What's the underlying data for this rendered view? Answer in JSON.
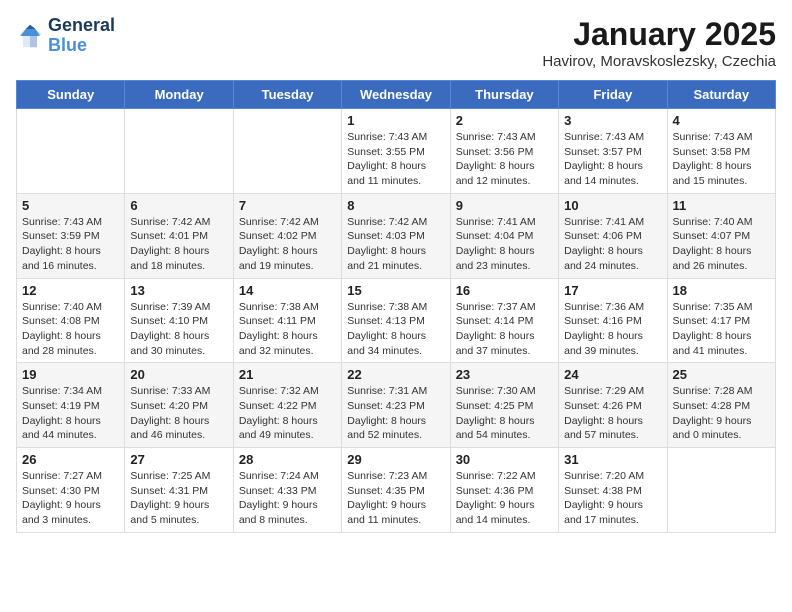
{
  "header": {
    "logo_line1": "General",
    "logo_line2": "Blue",
    "title": "January 2025",
    "subtitle": "Havirov, Moravskoslezsky, Czechia"
  },
  "days_of_week": [
    "Sunday",
    "Monday",
    "Tuesday",
    "Wednesday",
    "Thursday",
    "Friday",
    "Saturday"
  ],
  "weeks": [
    [
      {
        "day": "",
        "info": ""
      },
      {
        "day": "",
        "info": ""
      },
      {
        "day": "",
        "info": ""
      },
      {
        "day": "1",
        "info": "Sunrise: 7:43 AM\nSunset: 3:55 PM\nDaylight: 8 hours\nand 11 minutes."
      },
      {
        "day": "2",
        "info": "Sunrise: 7:43 AM\nSunset: 3:56 PM\nDaylight: 8 hours\nand 12 minutes."
      },
      {
        "day": "3",
        "info": "Sunrise: 7:43 AM\nSunset: 3:57 PM\nDaylight: 8 hours\nand 14 minutes."
      },
      {
        "day": "4",
        "info": "Sunrise: 7:43 AM\nSunset: 3:58 PM\nDaylight: 8 hours\nand 15 minutes."
      }
    ],
    [
      {
        "day": "5",
        "info": "Sunrise: 7:43 AM\nSunset: 3:59 PM\nDaylight: 8 hours\nand 16 minutes."
      },
      {
        "day": "6",
        "info": "Sunrise: 7:42 AM\nSunset: 4:01 PM\nDaylight: 8 hours\nand 18 minutes."
      },
      {
        "day": "7",
        "info": "Sunrise: 7:42 AM\nSunset: 4:02 PM\nDaylight: 8 hours\nand 19 minutes."
      },
      {
        "day": "8",
        "info": "Sunrise: 7:42 AM\nSunset: 4:03 PM\nDaylight: 8 hours\nand 21 minutes."
      },
      {
        "day": "9",
        "info": "Sunrise: 7:41 AM\nSunset: 4:04 PM\nDaylight: 8 hours\nand 23 minutes."
      },
      {
        "day": "10",
        "info": "Sunrise: 7:41 AM\nSunset: 4:06 PM\nDaylight: 8 hours\nand 24 minutes."
      },
      {
        "day": "11",
        "info": "Sunrise: 7:40 AM\nSunset: 4:07 PM\nDaylight: 8 hours\nand 26 minutes."
      }
    ],
    [
      {
        "day": "12",
        "info": "Sunrise: 7:40 AM\nSunset: 4:08 PM\nDaylight: 8 hours\nand 28 minutes."
      },
      {
        "day": "13",
        "info": "Sunrise: 7:39 AM\nSunset: 4:10 PM\nDaylight: 8 hours\nand 30 minutes."
      },
      {
        "day": "14",
        "info": "Sunrise: 7:38 AM\nSunset: 4:11 PM\nDaylight: 8 hours\nand 32 minutes."
      },
      {
        "day": "15",
        "info": "Sunrise: 7:38 AM\nSunset: 4:13 PM\nDaylight: 8 hours\nand 34 minutes."
      },
      {
        "day": "16",
        "info": "Sunrise: 7:37 AM\nSunset: 4:14 PM\nDaylight: 8 hours\nand 37 minutes."
      },
      {
        "day": "17",
        "info": "Sunrise: 7:36 AM\nSunset: 4:16 PM\nDaylight: 8 hours\nand 39 minutes."
      },
      {
        "day": "18",
        "info": "Sunrise: 7:35 AM\nSunset: 4:17 PM\nDaylight: 8 hours\nand 41 minutes."
      }
    ],
    [
      {
        "day": "19",
        "info": "Sunrise: 7:34 AM\nSunset: 4:19 PM\nDaylight: 8 hours\nand 44 minutes."
      },
      {
        "day": "20",
        "info": "Sunrise: 7:33 AM\nSunset: 4:20 PM\nDaylight: 8 hours\nand 46 minutes."
      },
      {
        "day": "21",
        "info": "Sunrise: 7:32 AM\nSunset: 4:22 PM\nDaylight: 8 hours\nand 49 minutes."
      },
      {
        "day": "22",
        "info": "Sunrise: 7:31 AM\nSunset: 4:23 PM\nDaylight: 8 hours\nand 52 minutes."
      },
      {
        "day": "23",
        "info": "Sunrise: 7:30 AM\nSunset: 4:25 PM\nDaylight: 8 hours\nand 54 minutes."
      },
      {
        "day": "24",
        "info": "Sunrise: 7:29 AM\nSunset: 4:26 PM\nDaylight: 8 hours\nand 57 minutes."
      },
      {
        "day": "25",
        "info": "Sunrise: 7:28 AM\nSunset: 4:28 PM\nDaylight: 9 hours\nand 0 minutes."
      }
    ],
    [
      {
        "day": "26",
        "info": "Sunrise: 7:27 AM\nSunset: 4:30 PM\nDaylight: 9 hours\nand 3 minutes."
      },
      {
        "day": "27",
        "info": "Sunrise: 7:25 AM\nSunset: 4:31 PM\nDaylight: 9 hours\nand 5 minutes."
      },
      {
        "day": "28",
        "info": "Sunrise: 7:24 AM\nSunset: 4:33 PM\nDaylight: 9 hours\nand 8 minutes."
      },
      {
        "day": "29",
        "info": "Sunrise: 7:23 AM\nSunset: 4:35 PM\nDaylight: 9 hours\nand 11 minutes."
      },
      {
        "day": "30",
        "info": "Sunrise: 7:22 AM\nSunset: 4:36 PM\nDaylight: 9 hours\nand 14 minutes."
      },
      {
        "day": "31",
        "info": "Sunrise: 7:20 AM\nSunset: 4:38 PM\nDaylight: 9 hours\nand 17 minutes."
      },
      {
        "day": "",
        "info": ""
      }
    ]
  ]
}
